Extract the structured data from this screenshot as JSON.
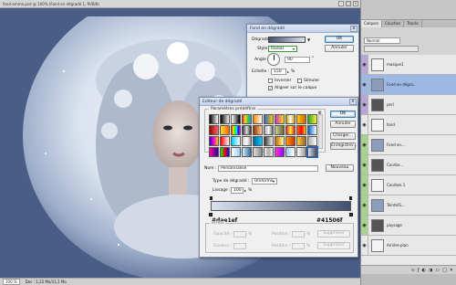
{
  "window": {
    "title": "fond-emma.psd @ 100% (Fond en dégradé 1, RVB/8)"
  },
  "statusbar": {
    "zoom": "100 %",
    "doc_info": "Doc : 1,22 Mo/11,1 Mo"
  },
  "gradient_fill": {
    "title": "Fond en dégradé",
    "close": "x",
    "label_gradient": "Dégradé :",
    "label_style": "Style :",
    "style_value": "Radial",
    "label_angle": "Angle :",
    "angle_value": "90",
    "angle_unit": "°",
    "label_scale": "Echelle :",
    "scale_value": "150",
    "scale_unit": "%",
    "reverse_label": "Inverser",
    "dither_label": "Simuler",
    "align_label": "Aligner sur le calque",
    "ok": "OK",
    "cancel": "Annuler"
  },
  "gradient_editor": {
    "title": "Editeur de dégradé",
    "close": "x",
    "presets_legend": "Paramètres prédéfinis",
    "gear": "⚙",
    "ok": "OK",
    "cancel": "Annuler",
    "load": "Charger...",
    "save": "Enregistrer...",
    "name_label": "Nom :",
    "name_value": "Personnalisé",
    "new_button": "Nouveau",
    "type_label": "Type de dégradé :",
    "type_value": "Uniforme",
    "smooth_label": "Lissage :",
    "smooth_value": "100",
    "smooth_unit": "%",
    "left_hex": "#dae1ef",
    "right_hex": "#41506f",
    "stops_legend": "Arrêts",
    "opacity_label": "Opacité :",
    "opacity_unit": "%",
    "location_label": "Position :",
    "location_unit": "%",
    "delete_label": "Supprimer",
    "color_label": "Couleur :",
    "location2_label": "Position :",
    "location2_unit": "%",
    "delete2_label": "Supprimer",
    "swatches": [
      "linear-gradient(90deg,#000,#fff)",
      "linear-gradient(90deg,#000,transparent)",
      "linear-gradient(90deg,#fff,#000)",
      "linear-gradient(90deg,#e23,#fd2,#3c3,#29e)",
      "linear-gradient(90deg,#f80,#fff)",
      "linear-gradient(90deg,#36c,#fc0)",
      "linear-gradient(90deg,#c3c,#fd0)",
      "linear-gradient(90deg,#b90,#fff,#b90)",
      "linear-gradient(90deg,#fc0,#c60)",
      "linear-gradient(90deg,#2a2,#fe3)",
      "linear-gradient(90deg,#900,#f66)",
      "linear-gradient(90deg,#fd3,#f60)",
      "linear-gradient(90deg,#f00,#ff0,#0f0,#0ff,#00f,#f0f)",
      "linear-gradient(90deg,#333,#ddd,#333)",
      "linear-gradient(90deg,#930,#fc9)",
      "linear-gradient(90deg,#999,#fff,#666)",
      "linear-gradient(90deg,#cc9,#663)",
      "linear-gradient(90deg,#e22,#fe3,#e22)",
      "linear-gradient(90deg,#f60,#f00,#fc0)",
      "linear-gradient(90deg,#06c,#fff)",
      "linear-gradient(90deg,#30c,#f0c,#fc0)",
      "linear-gradient(90deg,#f00,#fff)",
      "linear-gradient(90deg,#0cf,#fff)",
      "linear-gradient(90deg,#ccc,#fff,#999)",
      "linear-gradient(90deg,#069,#0cf)",
      "linear-gradient(90deg,#333,#999,#eee)",
      "linear-gradient(90deg,#c60,#ff9)",
      "linear-gradient(90deg,#f90,#c30)",
      "linear-gradient(90deg,#fc3,#963)",
      "linear-gradient(90deg,#aaa,#fff)",
      "linear-gradient(90deg,#f09,#309)",
      "linear-gradient(90deg,#0f0,#f00,#00f)",
      "linear-gradient(90deg,#fff,#9cf)",
      "linear-gradient(90deg,#cef,#369)",
      "linear-gradient(90deg,#ddd,#888)",
      "linear-gradient(90deg,#eee,#aaa,#eee)",
      "linear-gradient(90deg,#f3c,#90f)",
      "linear-gradient(90deg,#9cf,#fff)",
      "linear-gradient(90deg,#fff,#999)",
      "linear-gradient(90deg,#dae1ef,#41506f)"
    ]
  },
  "layers_panel": {
    "tabs": [
      "Calques",
      "Couches",
      "Tracés"
    ],
    "blend_mode": "Normal",
    "layers": [
      {
        "name": "masque1",
        "color": "purple"
      },
      {
        "name": "Fond en dégra...",
        "color": "selected"
      },
      {
        "name": "perl",
        "color": "purple"
      },
      {
        "name": "fond",
        "color": "none"
      },
      {
        "name": "Fond en...",
        "color": "green"
      },
      {
        "name": "Courbe...",
        "color": "green"
      },
      {
        "name": "Courbes 1",
        "color": "green"
      },
      {
        "name": "Teinte/S...",
        "color": "green"
      },
      {
        "name": "paysage",
        "color": "green"
      },
      {
        "name": "Arrière-plan",
        "color": "none"
      }
    ],
    "footer_icons": [
      "link-icon",
      "fx-icon",
      "mask-icon",
      "adjust-icon",
      "folder-icon",
      "new-icon",
      "trash-icon"
    ]
  },
  "colors": {
    "canvas_bg": "#4a5d86",
    "gradient_start": "#dae1ef",
    "gradient_end": "#41506f",
    "accent": "#3c7fb1"
  }
}
